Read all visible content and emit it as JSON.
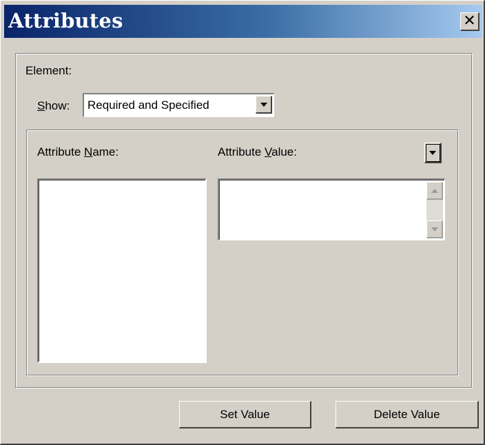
{
  "window": {
    "title": "Attributes",
    "close_glyph": "✕"
  },
  "element": {
    "label": "Element:"
  },
  "show": {
    "label_mnemonic": "S",
    "label_rest": "how:",
    "selected": "Required and Specified",
    "dropdown_icon": "chevron-down-icon"
  },
  "attr_name": {
    "label_prefix": "Attribute ",
    "label_mnemonic": "N",
    "label_rest": "ame:"
  },
  "attr_value": {
    "label_prefix": "Attribute ",
    "label_mnemonic": "V",
    "label_rest": "alue:"
  },
  "buttons": {
    "set_value": "Set Value",
    "delete_value": "Delete Value"
  },
  "colors": {
    "face": "#d4d0c8",
    "title_start": "#0a246a",
    "title_end": "#a6caf0",
    "field": "#ffffff"
  }
}
